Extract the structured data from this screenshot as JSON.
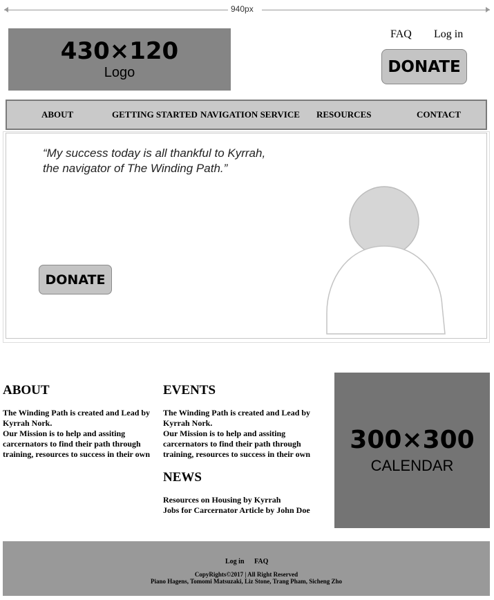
{
  "ruler": {
    "label": "940px"
  },
  "header": {
    "logo": {
      "dimensions": "430×120",
      "caption": "Logo"
    },
    "links": {
      "faq": "FAQ",
      "login": "Log in"
    },
    "donate": "DONATE"
  },
  "nav": {
    "items": [
      "ABOUT",
      "GETTING STARTED",
      "NAVIGATION SERVICE",
      "RESOURCES",
      "CONTACT"
    ]
  },
  "hero": {
    "quote_line1": "“My success today is all thankful to Kyrrah,",
    "quote_line2": "the navigator of The Winding Path.”",
    "donate": "DONATE"
  },
  "about": {
    "title": "ABOUT",
    "lines": [
      "The Winding Path is created and Lead by",
      "Kyrrah Nork.",
      "Our Mission is to help and assiting",
      "carcernators to find their path through",
      "training, resources to success in their own"
    ]
  },
  "events": {
    "title": "EVENTS",
    "lines": [
      "The Winding Path is created and Lead by",
      "Kyrrah Nork.",
      "Our Mission is to help and assiting",
      "carcernators to find their path through",
      "training, resources to success in their own"
    ]
  },
  "news": {
    "title": "NEWS",
    "items": [
      "Resources on Housing by Kyrrah",
      "Jobs for Carcernator Article by John Doe"
    ]
  },
  "calendar": {
    "dimensions": "300×300",
    "caption": "CALENDAR"
  },
  "footer": {
    "login": "Log in",
    "faq": "FAQ",
    "copyright": "CopyRights©2017 | All Right Reserved",
    "authors": "Piano Hagens, Tomomi Matsuzaki, Liz Stone, Trang Pham, Sicheng Zho"
  },
  "colors": {
    "logo_bg": "#858585",
    "nav_bg": "#c9c9c9",
    "button_bg": "#c4c4c4",
    "calendar_bg": "#747474",
    "footer_bg": "#999999"
  }
}
